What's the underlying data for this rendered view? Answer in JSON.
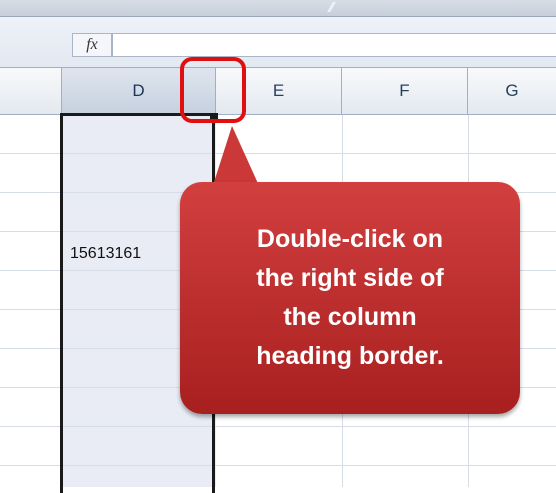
{
  "formula_bar": {
    "fx_label": "fx",
    "value": ""
  },
  "columns": [
    {
      "letter": "",
      "selected": false
    },
    {
      "letter": "D",
      "selected": true
    },
    {
      "letter": "E",
      "selected": false
    },
    {
      "letter": "F",
      "selected": false
    },
    {
      "letter": "G",
      "selected": false
    }
  ],
  "cells": {
    "d_value": "15613161"
  },
  "callout": {
    "line1": "Double-click on",
    "line2": "the right side of",
    "line3": "the column",
    "line4": "heading border."
  },
  "colors": {
    "callout": "#b92d2d",
    "highlight": "#e01010",
    "selected_column": "#e9ecf5"
  }
}
